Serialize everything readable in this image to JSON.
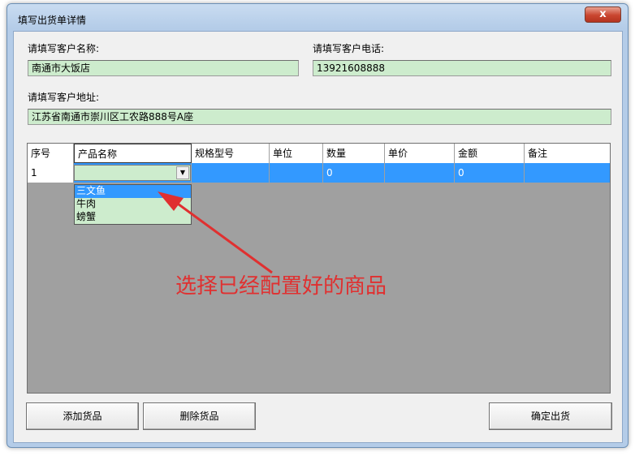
{
  "window": {
    "title": "填写出货单详情",
    "close_label": "x"
  },
  "form": {
    "customer_name_label": "请填写客户名称:",
    "customer_name_value": "南通市大饭店",
    "customer_phone_label": "请填写客户电话:",
    "customer_phone_value": "13921608888",
    "customer_address_label": "请填写客户地址:",
    "customer_address_value": "江苏省南通市崇川区工农路888号A座"
  },
  "grid": {
    "columns": [
      "序号",
      "产品名称",
      "规格型号",
      "单位",
      "数量",
      "单价",
      "金额",
      "备注"
    ],
    "rows": [
      {
        "index": "1",
        "product": "",
        "spec": "",
        "unit": "",
        "qty": "0",
        "price": "",
        "amount": "0",
        "note": ""
      }
    ]
  },
  "dropdown": {
    "options": [
      "三文鱼",
      "牛肉",
      "螃蟹"
    ],
    "highlighted": "三文鱼"
  },
  "annotation": {
    "text": "选择已经配置好的商品",
    "color": "#e03030"
  },
  "buttons": {
    "add": "添加货品",
    "delete": "删除货品",
    "confirm": "确定出货"
  },
  "colors": {
    "field_bg": "#cdeccd",
    "selection": "#3399ff",
    "grid_bg": "#a0a0a0"
  }
}
